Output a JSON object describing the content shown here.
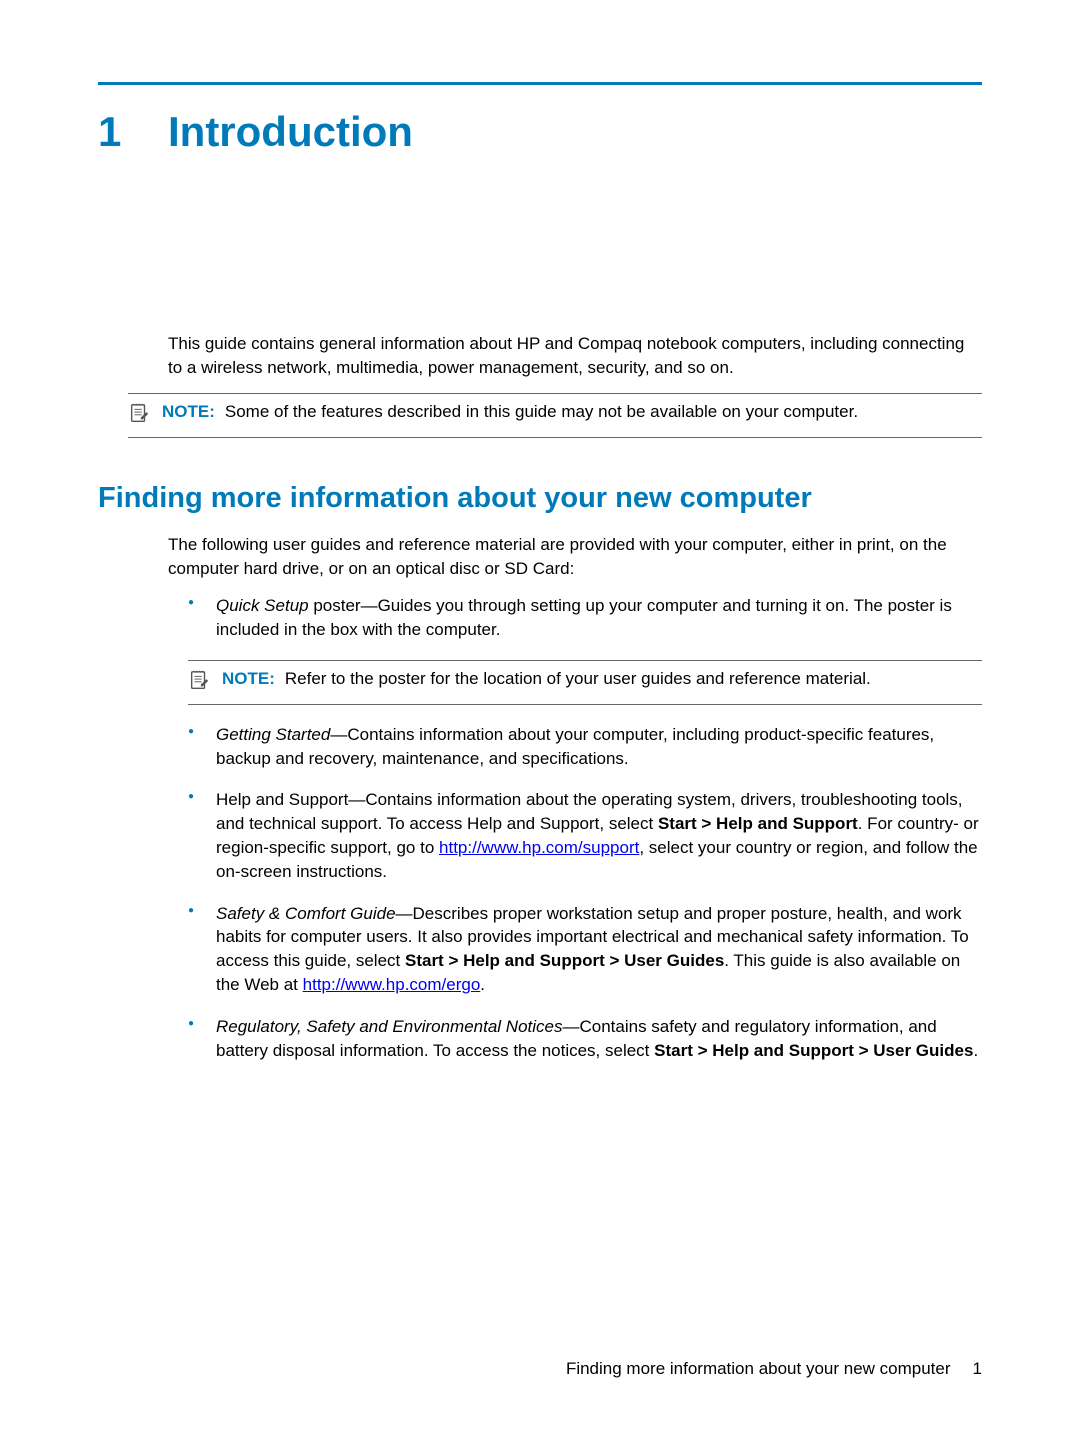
{
  "chapter": {
    "number": "1",
    "title": "Introduction"
  },
  "intro_paragraph": "This guide contains general information about HP and Compaq notebook computers, including connecting to a wireless network, multimedia, power management, security, and so on.",
  "note1": {
    "label": "NOTE:",
    "text": "Some of the features described in this guide may not be available on your computer."
  },
  "section": {
    "title": "Finding more information about your new computer",
    "intro": "The following user guides and reference material are provided with your computer, either in print, on the computer hard drive, or on an optical disc or SD Card:"
  },
  "bullet1": {
    "italic": "Quick Setup",
    "rest": " poster—Guides you through setting up your computer and turning it on. The poster is included in the box with the computer."
  },
  "note2": {
    "label": "NOTE:",
    "text": "Refer to the poster for the location of your user guides and reference material."
  },
  "bullet2": {
    "italic": "Getting Started",
    "rest": "—Contains information about your computer, including product-specific features, backup and recovery, maintenance, and specifications."
  },
  "bullet3": {
    "pre": "Help and Support—Contains information about the operating system, drivers, troubleshooting tools, and technical support. To access Help and Support, select ",
    "bold1": "Start > Help and Support",
    "mid": ". For country- or region-specific support, go to ",
    "link": "http://www.hp.com/support",
    "post": ", select your country or region, and follow the on-screen instructions."
  },
  "bullet4": {
    "italic": "Safety & Comfort Guide",
    "pre": "—Describes proper workstation setup and proper posture, health, and work habits for computer users. It also provides important electrical and mechanical safety information. To access this guide, select ",
    "bold1": "Start > Help and Support > User Guides",
    "mid": ". This guide is also available on the Web at ",
    "link": "http://www.hp.com/ergo",
    "post": "."
  },
  "bullet5": {
    "italic": "Regulatory, Safety and Environmental Notices",
    "pre": "—Contains safety and regulatory information, and battery disposal information. To access the notices, select ",
    "bold1": "Start > Help and Support > User Guides",
    "post": "."
  },
  "footer": {
    "text": "Finding more information about your new computer",
    "page": "1"
  }
}
